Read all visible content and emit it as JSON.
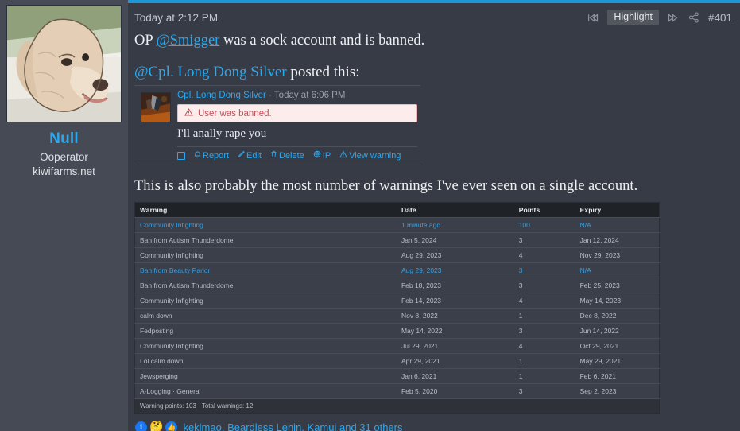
{
  "theme": {
    "bg": "#373b45",
    "sidebar_bg": "#454a54",
    "accent": "#1e97d8",
    "link": "#2ba9f0",
    "ban_bg": "#fcecec",
    "ban_text": "#c9505a"
  },
  "sidebar": {
    "avatar_alt": "dog-avatar",
    "username": "Null",
    "user_title": "Ooperator",
    "user_site": "kiwifarms.net"
  },
  "post_header": {
    "timestamp": "Today at 2:12 PM",
    "prev_icon": "rewind-icon",
    "highlight_label": "Highlight",
    "next_icon": "fast-forward-icon",
    "share_icon": "share-icon",
    "post_number": "#401"
  },
  "message": {
    "line1_before": "OP ",
    "line1_mention": "@Smigger",
    "line1_after": " was a sock account and is banned.",
    "quote_intro_mention": "@Cpl. Long Dong Silver",
    "quote_intro_after": " posted this:",
    "line2": "This is also probably the most number of warnings I've ever seen on a single account."
  },
  "quoted_post": {
    "avatar_alt": "quoted-user-avatar",
    "author": "Cpl. Long Dong Silver",
    "separator": "·",
    "timestamp": "Today at 6:06 PM",
    "ban_notice": "User was banned.",
    "ban_icon": "warning-triangle-icon",
    "body": "I'll anally rape you",
    "actions": [
      {
        "label": "Report",
        "icon": "bell-icon"
      },
      {
        "label": "Edit",
        "icon": "pencil-icon"
      },
      {
        "label": "Delete",
        "icon": "trash-icon"
      },
      {
        "label": "IP",
        "icon": "globe-icon"
      },
      {
        "label": "View warning",
        "icon": "warning-triangle-icon"
      }
    ]
  },
  "warnings_table": {
    "columns": [
      "Warning",
      "Date",
      "Points",
      "Expiry"
    ],
    "rows": [
      {
        "warning": "Community Infighting",
        "date": "1 minute ago",
        "points": "100",
        "expiry": "N/A",
        "highlight": true
      },
      {
        "warning": "Ban from Autism Thunderdome",
        "date": "Jan 5, 2024",
        "points": "3",
        "expiry": "Jan 12, 2024",
        "highlight": false
      },
      {
        "warning": "Community Infighting",
        "date": "Aug 29, 2023",
        "points": "4",
        "expiry": "Nov 29, 2023",
        "highlight": false
      },
      {
        "warning": "Ban from Beauty Parlor",
        "date": "Aug 29, 2023",
        "points": "3",
        "expiry": "N/A",
        "highlight": true
      },
      {
        "warning": "Ban from Autism Thunderdome",
        "date": "Feb 18, 2023",
        "points": "3",
        "expiry": "Feb 25, 2023",
        "highlight": false
      },
      {
        "warning": "Community Infighting",
        "date": "Feb 14, 2023",
        "points": "4",
        "expiry": "May 14, 2023",
        "highlight": false
      },
      {
        "warning": "calm down",
        "date": "Nov 8, 2022",
        "points": "1",
        "expiry": "Dec 8, 2022",
        "highlight": false
      },
      {
        "warning": "Fedposting",
        "date": "May 14, 2022",
        "points": "3",
        "expiry": "Jun 14, 2022",
        "highlight": false
      },
      {
        "warning": "Community Infighting",
        "date": "Jul 29, 2021",
        "points": "4",
        "expiry": "Oct 29, 2021",
        "highlight": false
      },
      {
        "warning": "Lol calm down",
        "date": "Apr 29, 2021",
        "points": "1",
        "expiry": "May 29, 2021",
        "highlight": false
      },
      {
        "warning": "Jewsperging",
        "date": "Jan 6, 2021",
        "points": "1",
        "expiry": "Feb 6, 2021",
        "highlight": false
      },
      {
        "warning": "A-Logging · General",
        "date": "Feb 5, 2020",
        "points": "3",
        "expiry": "Sep 2, 2023",
        "highlight": false
      }
    ],
    "footer": "Warning points: 103 · Total warnings: 12"
  },
  "reactions": {
    "icons": [
      "info-icon",
      "thinking-face-icon",
      "thumbs-up-icon"
    ],
    "names": "keklmao, Beardless Lenin, Kamui and 31 others"
  }
}
